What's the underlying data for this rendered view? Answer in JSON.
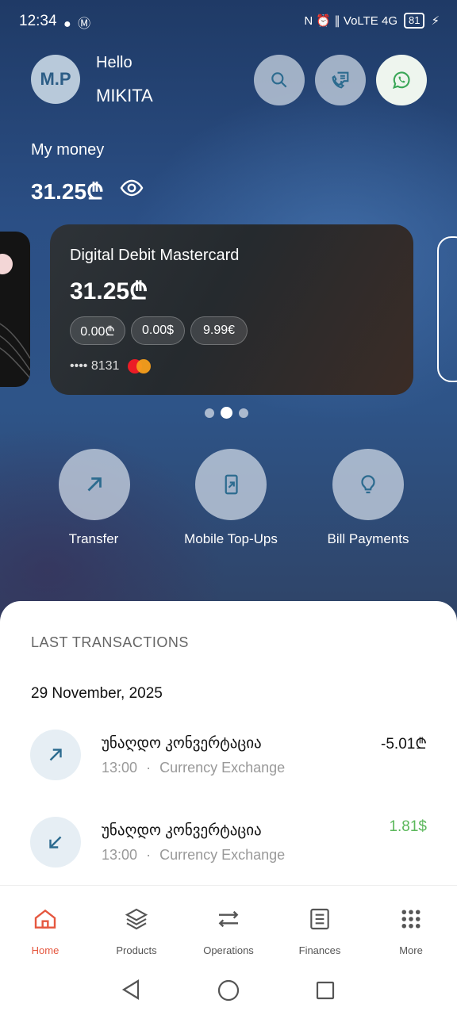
{
  "status": {
    "time": "12:34",
    "left_icons": "● Ⓜ",
    "right_icons": "N ⏰ ∥ VoLTE 4G",
    "battery": "81"
  },
  "header": {
    "avatar_initials": "M.P",
    "greeting": "Hello",
    "user_name": "MIKITA"
  },
  "balance": {
    "label": "My money",
    "value": "31.25₾"
  },
  "card": {
    "title": "Digital Debit Mastercard",
    "balance": "31.25₾",
    "currencies": [
      "0.00₾",
      "0.00$",
      "9.99€"
    ],
    "number": "•••• 8131"
  },
  "actions": [
    {
      "label": "Transfer",
      "icon": "arrow-up-right-icon"
    },
    {
      "label": "Mobile Top-Ups",
      "icon": "phone-topup-icon"
    },
    {
      "label": "Bill Payments",
      "icon": "lightbulb-icon"
    }
  ],
  "transactions": {
    "heading": "LAST TRANSACTIONS",
    "date": "29 November, 2025",
    "items": [
      {
        "title": "უნაღდო კონვერტაცია",
        "time": "13:00",
        "separator": "·",
        "category": "Currency Exchange",
        "amount": "-5.01₾",
        "amount_color": "#111111",
        "icon": "arrow-up-right-icon"
      },
      {
        "title": "უნაღდო კონვერტაცია",
        "time": "13:00",
        "separator": "·",
        "category": "Currency Exchange",
        "amount": "1.81$",
        "amount_color": "#5cb85c",
        "icon": "arrow-down-left-icon"
      }
    ]
  },
  "nav": [
    {
      "label": "Home",
      "icon": "home-icon",
      "active": true
    },
    {
      "label": "Products",
      "icon": "layers-icon"
    },
    {
      "label": "Operations",
      "icon": "transfer-arrows-icon"
    },
    {
      "label": "Finances",
      "icon": "document-list-icon"
    },
    {
      "label": "More",
      "icon": "grid-dots-icon"
    }
  ],
  "colors": {
    "accent": "#e5573f",
    "positive": "#5cb85c",
    "icon_blue": "#2c6b8f"
  }
}
